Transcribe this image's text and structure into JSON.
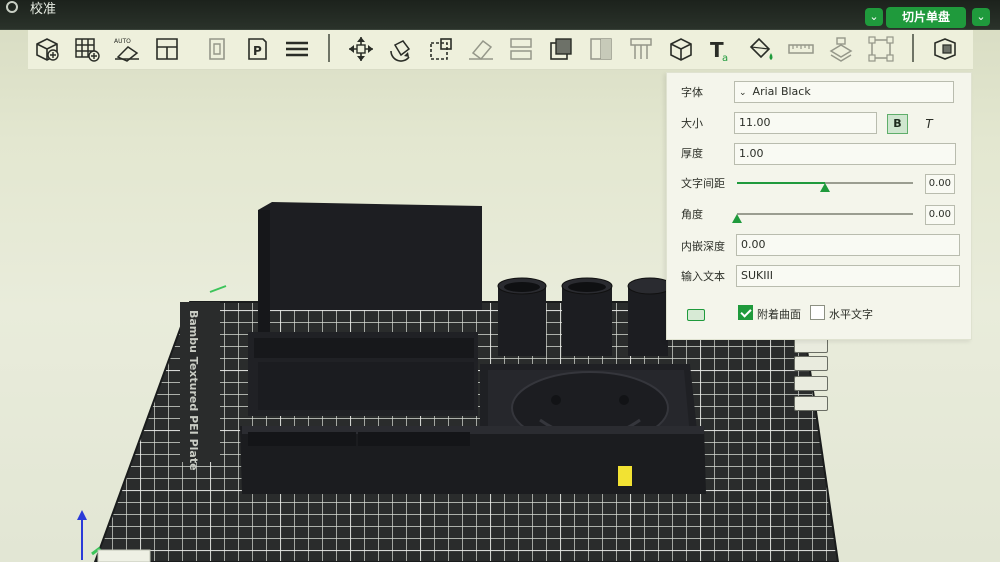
{
  "titlebar": {
    "title": "校准",
    "slice_button": "切片单盘",
    "menu_arrow": "⌄"
  },
  "toolbar": {
    "tools": [
      "add-cube-icon",
      "add-plate-grid-icon",
      "auto-orient-icon",
      "arrange-icon",
      "plate-icon",
      "plate-p-icon",
      "layers-icon",
      "move-icon",
      "rotate-icon",
      "scale-icon",
      "lay-on-face-icon",
      "split-icon",
      "cut-icon",
      "boolean-icon",
      "support-icon",
      "cube-icon",
      "text-tool-icon",
      "paint-icon",
      "measure-icon",
      "assembly-icon",
      "bounding-box-icon",
      "explode-icon"
    ]
  },
  "text_panel": {
    "font_label": "字体",
    "font_value": "Arial Black",
    "size_label": "大小",
    "size_value": "11.00",
    "bold_label": "B",
    "italic_label": "T",
    "thickness_label": "厚度",
    "thickness_value": "1.00",
    "spacing_label": "文字间距",
    "spacing_value": "0.00",
    "spacing_level": 0.5,
    "angle_label": "角度",
    "angle_value": "0.00",
    "angle_level": 0.0,
    "embed_depth_label": "内嵌深度",
    "embed_depth_value": "0.00",
    "input_text_label": "输入文本",
    "input_text_value": "SUKIII",
    "attach_surface_label": "附着曲面",
    "attach_surface_checked": true,
    "horizontal_text_label": "水平文字",
    "horizontal_text_checked": false
  },
  "scene": {
    "plate_label": "Bambu Textured PEI Plate",
    "plate_color": "#2a2c2c",
    "model_color": "#1c1d20",
    "accent_color": "#1f9a3c",
    "text_marker_color": "#f2e233"
  }
}
